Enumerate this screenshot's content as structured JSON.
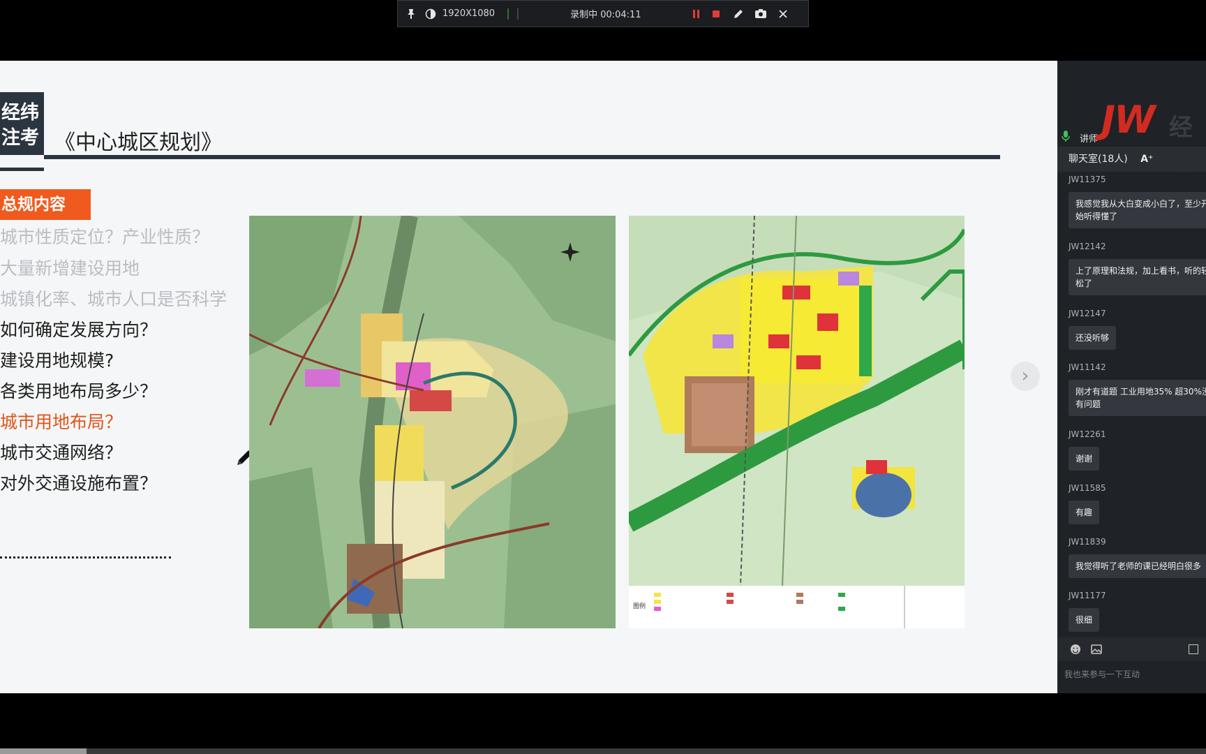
{
  "recorder": {
    "resolution": "1920X1080",
    "status": "录制中 00:04:11"
  },
  "slide": {
    "logo_line1": "经纬",
    "logo_line2": "注考",
    "title": "《中心城区规划》",
    "section_tag": "总规内容",
    "questions": [
      "城市性质定位？产业性质？",
      "大量新增建设用地",
      "城镇化率、城市人口是否科学",
      "如何确定发展方向？",
      "建设用地规模?",
      "各类用地布局多少？",
      "城市用地布局？",
      "城市交通网络？",
      "对外交通设施布置？"
    ],
    "map_right_legend_label": "图例"
  },
  "panel": {
    "role_label": "讲师",
    "brand": "JW",
    "brand_cn": "经纬",
    "chat_title": "聊天室(18人)",
    "font_button": "A⁺",
    "messages": [
      {
        "user": "JW11375",
        "text": "我感觉我从大白变成小白了，至少开始听得懂了"
      },
      {
        "user": "JW12142",
        "text": "上了原理和法规，加上看书，听的轻松了"
      },
      {
        "user": "JW12147",
        "text": "还没听够"
      },
      {
        "user": "JW11142",
        "text": "刚才有道题 工业用地35% 超30%没有问题"
      },
      {
        "user": "JW12261",
        "text": "谢谢"
      },
      {
        "user": "JW11585",
        "text": "有趣"
      },
      {
        "user": "JW11839",
        "text": "我觉得听了老师的课已经明白很多"
      },
      {
        "user": "JW11177",
        "text": "很细"
      }
    ],
    "input_placeholder": "我也来参与一下互动"
  },
  "colors": {
    "accent": "#f05a1e",
    "slide_dark": "#2b3540",
    "panel_bg": "#1f2226",
    "brand_red": "#d22b20"
  }
}
